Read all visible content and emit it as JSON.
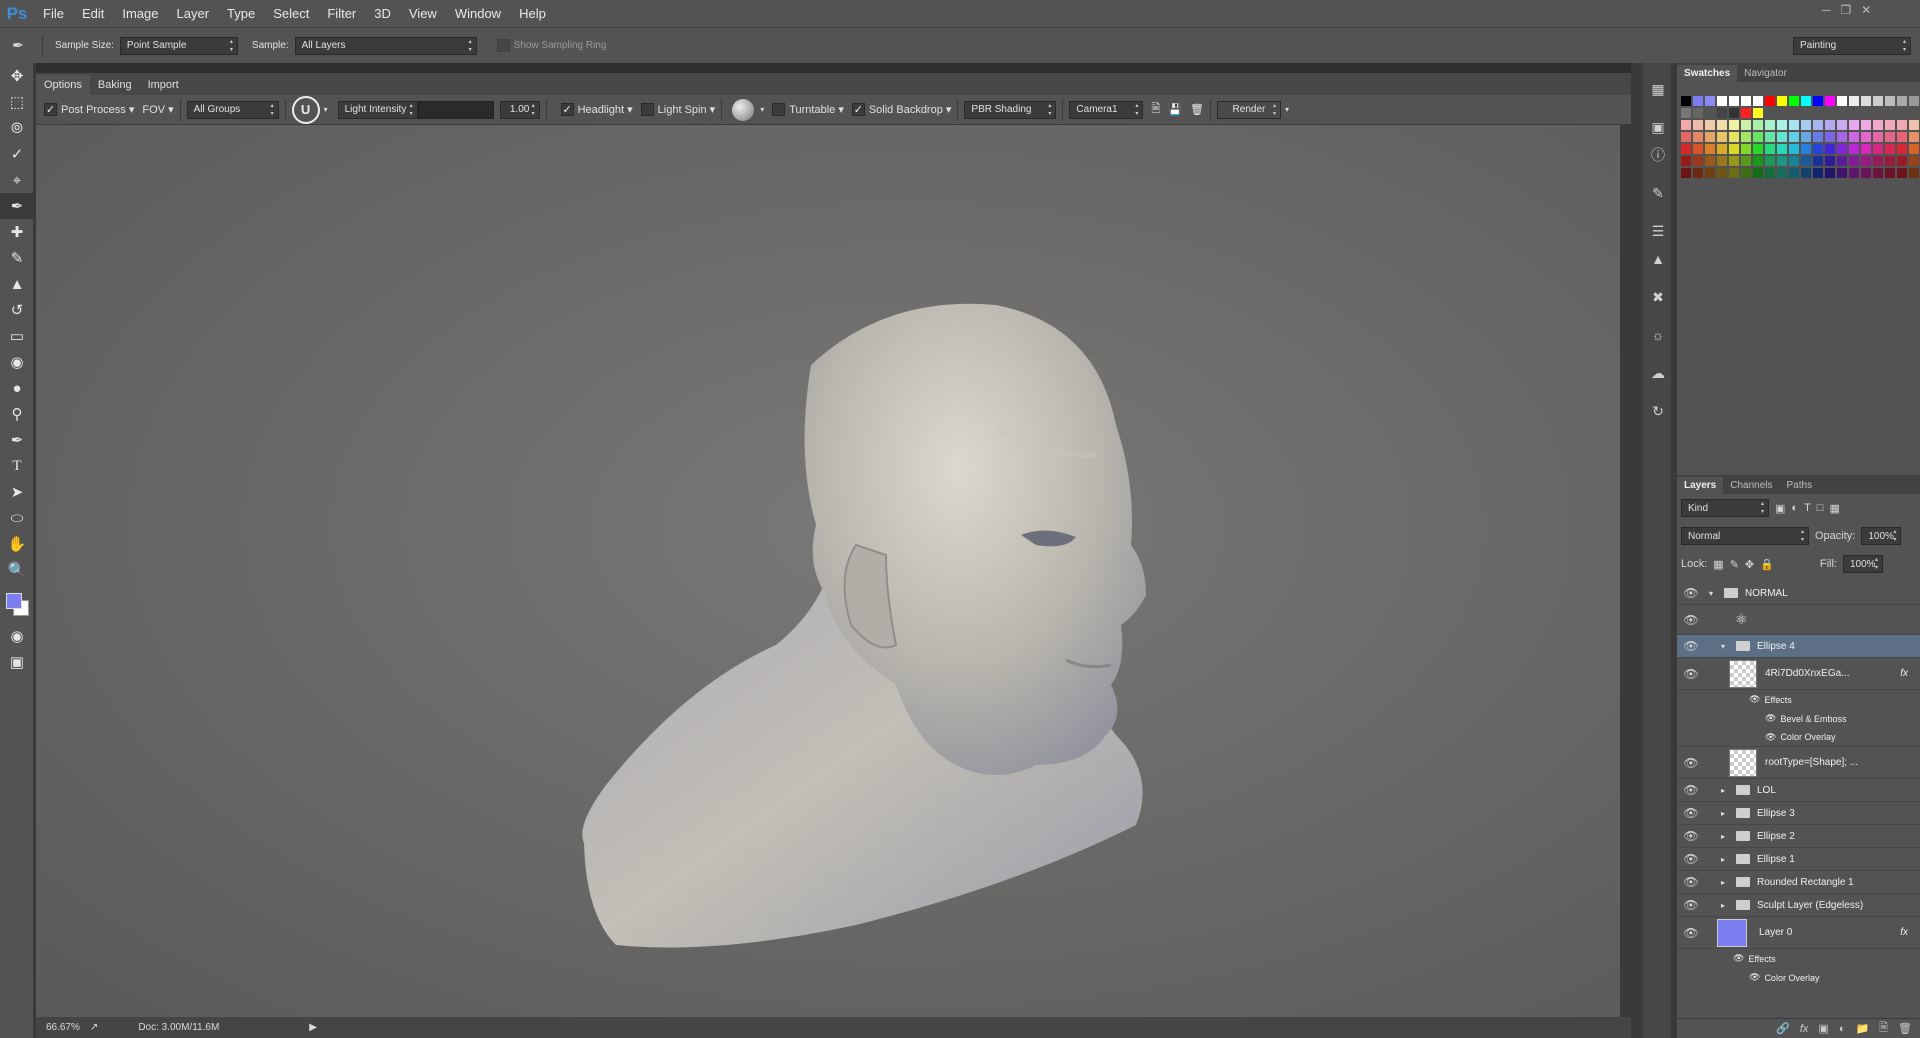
{
  "app": {
    "logo": "Ps"
  },
  "menu": [
    "File",
    "Edit",
    "Image",
    "Layer",
    "Type",
    "Select",
    "Filter",
    "3D",
    "View",
    "Window",
    "Help"
  ],
  "options": {
    "sample_size_label": "Sample Size:",
    "sample_size_value": "Point Sample",
    "sample_label": "Sample:",
    "sample_value": "All Layers",
    "show_ring_label": "Show Sampling Ring",
    "workspace": "Painting"
  },
  "doc_tabs": [
    "Options",
    "Baking",
    "Import"
  ],
  "threed": {
    "post_process": "Post Process",
    "fov": "FOV",
    "groups": "All Groups",
    "light_intensity_label": "Light Intensity",
    "light_intensity_value": "1.00",
    "headlight": "Headlight",
    "light_spin": "Light Spin",
    "turntable": "Turntable",
    "solid_backdrop": "Solid Backdrop",
    "shading": "PBR Shading",
    "camera": "Camera1",
    "render": "Render"
  },
  "status": {
    "zoom": "66.67%",
    "doc": "Doc: 3.00M/11.6M"
  },
  "panels": {
    "top_tabs": [
      "Swatches",
      "Navigator"
    ],
    "layer_tabs": [
      "Layers",
      "Channels",
      "Paths"
    ],
    "kind": "Kind",
    "blend_mode": "Normal",
    "opacity_label": "Opacity:",
    "opacity_value": "100%",
    "lock_label": "Lock:",
    "fill_label": "Fill:",
    "fill_value": "100%"
  },
  "layers": {
    "normal_group": "NORMAL",
    "ellipse4": "Ellipse 4",
    "shape_layer": "4Ri7Dd0XnxEGa...",
    "effects": "Effects",
    "bevel": "Bevel & Emboss",
    "color_overlay": "Color Overlay",
    "root_type": "rootType=[Shape]; ...",
    "lol": "LOL",
    "ellipse3": "Ellipse 3",
    "ellipse2": "Ellipse 2",
    "ellipse1": "Ellipse 1",
    "rounded_rect": "Rounded Rectangle 1",
    "sculpt": "Sculpt Layer (Edgeless)",
    "layer0": "Layer 0",
    "effects2": "Effects",
    "color_overlay2": "Color Overlay"
  },
  "colors": {
    "accent": "#5d6f85",
    "fg_swatch": "#7b7cf0"
  }
}
